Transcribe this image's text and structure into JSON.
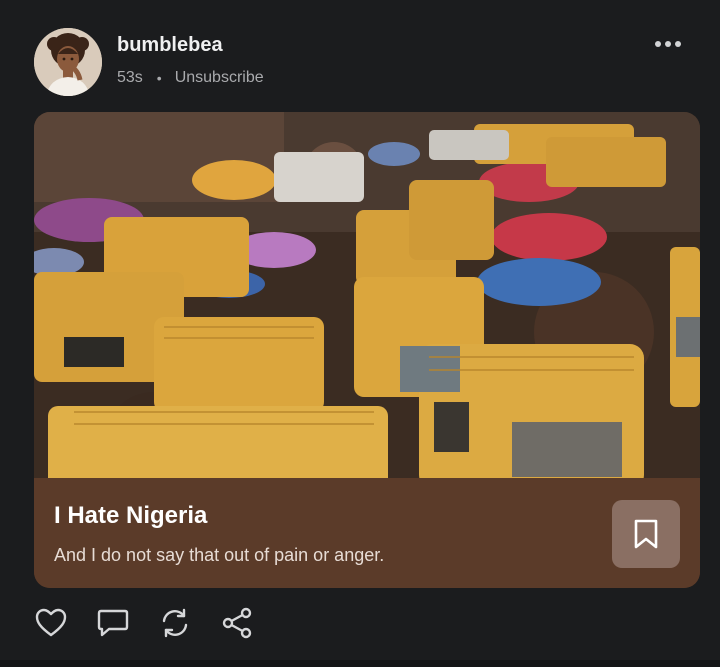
{
  "post": {
    "author": "bumblebea",
    "time": "53s",
    "separator": "•",
    "unsubscribe_label": "Unsubscribe",
    "more_icon": "more-horizontal-icon",
    "card": {
      "title": "I Hate Nigeria",
      "subtitle": "And I do not say that out of pain or anger.",
      "bookmark_icon": "bookmark-icon",
      "accent_color": "#5b3b29"
    },
    "actions": [
      {
        "icon": "heart-icon"
      },
      {
        "icon": "comment-icon"
      },
      {
        "icon": "repost-icon"
      },
      {
        "icon": "share-icon"
      }
    ]
  }
}
